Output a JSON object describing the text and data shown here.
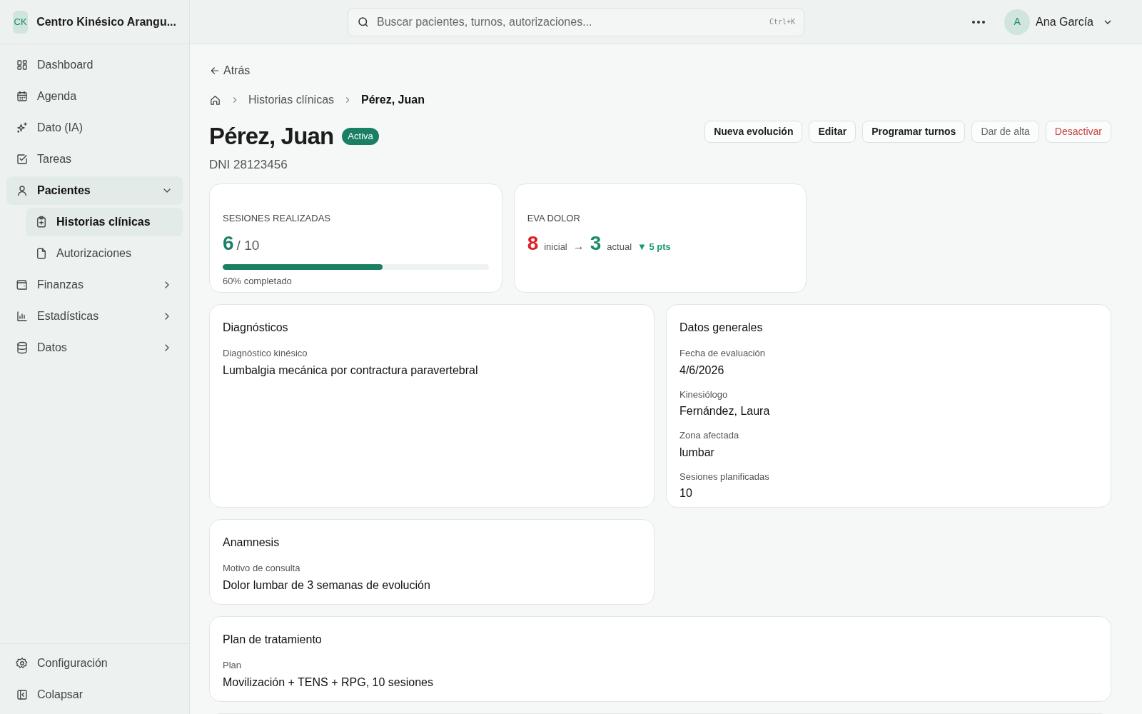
{
  "app": {
    "initials": "CK",
    "name": "Centro Kinésico Arangu..."
  },
  "sidebar": {
    "items": [
      {
        "label": "Dashboard",
        "selected": false
      },
      {
        "label": "Agenda",
        "selected": false
      },
      {
        "label": "Dato (IA)",
        "selected": false
      },
      {
        "label": "Tareas",
        "selected": false
      },
      {
        "label": "Pacientes",
        "expanded": true,
        "children": [
          {
            "label": "Historias clínicas",
            "selected": true
          },
          {
            "label": "Autorizaciones",
            "selected": false
          }
        ]
      },
      {
        "label": "Finanzas",
        "selected": false,
        "expanded": false
      },
      {
        "label": "Estadísticas",
        "selected": false,
        "expanded": false
      },
      {
        "label": "Datos",
        "selected": false,
        "expanded": false
      }
    ],
    "footer": [
      {
        "label": "Configuración"
      },
      {
        "label": "Colapsar"
      }
    ]
  },
  "topbar": {
    "search": {
      "placeholder": "Buscar pacientes, turnos, autorizaciones...",
      "shortcut": "Ctrl+K"
    },
    "user": {
      "initial": "A",
      "name": "Ana García"
    }
  },
  "back": "Atrás",
  "breadcrumb": [
    "Historias clínicas",
    "Pérez, Juan"
  ],
  "patient": {
    "name": "Pérez, Juan",
    "status": "Activa",
    "dni": "DNI 28123456"
  },
  "actions": [
    {
      "label": "Nueva evolución",
      "kind": "default"
    },
    {
      "label": "Editar",
      "kind": "default"
    },
    {
      "label": "Programar turnos",
      "kind": "default"
    },
    {
      "label": "Dar de alta",
      "kind": "muted"
    },
    {
      "label": "Desactivar",
      "kind": "danger"
    }
  ],
  "sessions": {
    "label": "SESIONES REALIZADAS",
    "done": "6",
    "total": "/ 10",
    "level": 0.6,
    "caption": "60% completado"
  },
  "pain": {
    "label": "EVA DOLOR",
    "initial": "8",
    "initial_label": "inicial",
    "arrow": "→",
    "current": "3",
    "current_label": "actual",
    "change": "▼ 5 pts"
  },
  "panels": [
    {
      "title": "Diagnósticos",
      "full_width": false,
      "fields": [
        {
          "label": "Diagnóstico kinésico",
          "value": "Lumbalgia mecánica por contractura paravertebral"
        }
      ]
    },
    {
      "title": "Datos generales",
      "full_width": false,
      "fields": [
        {
          "label": "Fecha de evaluación",
          "value": "4/6/2026"
        },
        {
          "label": "Kinesiólogo",
          "value": "Fernández, Laura"
        },
        {
          "label": "Zona afectada",
          "value": "lumbar"
        },
        {
          "label": "Sesiones planificadas",
          "value": "10"
        }
      ]
    },
    {
      "title": "Anamnesis",
      "full_width": false,
      "fields": [
        {
          "label": "Motivo de consulta",
          "value": "Dolor lumbar de 3 semanas de evolución"
        }
      ]
    },
    {
      "title": "Plan de tratamiento",
      "full_width": true,
      "fields": [
        {
          "label": "Plan",
          "value": "Movilización + TENS + RPG, 10 sesiones"
        }
      ]
    }
  ]
}
